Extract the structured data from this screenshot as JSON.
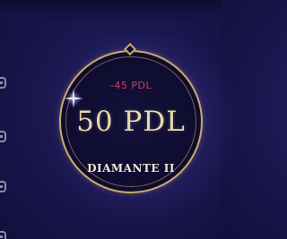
{
  "lp_panel": {
    "lp_change": "-45 PDL",
    "lp_total": "50 PDL",
    "rank": "DIAMANTE II"
  },
  "icons": {
    "side_icons": [
      "lock-icon",
      "lock-icon",
      "lock-icon",
      "lock-icon"
    ],
    "emblem_ornament": "diamond-gem-icon",
    "emblem_accent": "sparkle-icon"
  },
  "colors": {
    "background": "#1b1750",
    "gold": "#c8aa6e",
    "lp_loss": "#c9435a",
    "lp_total": "#e8d7ac",
    "rank_text": "#f0e6d2"
  }
}
